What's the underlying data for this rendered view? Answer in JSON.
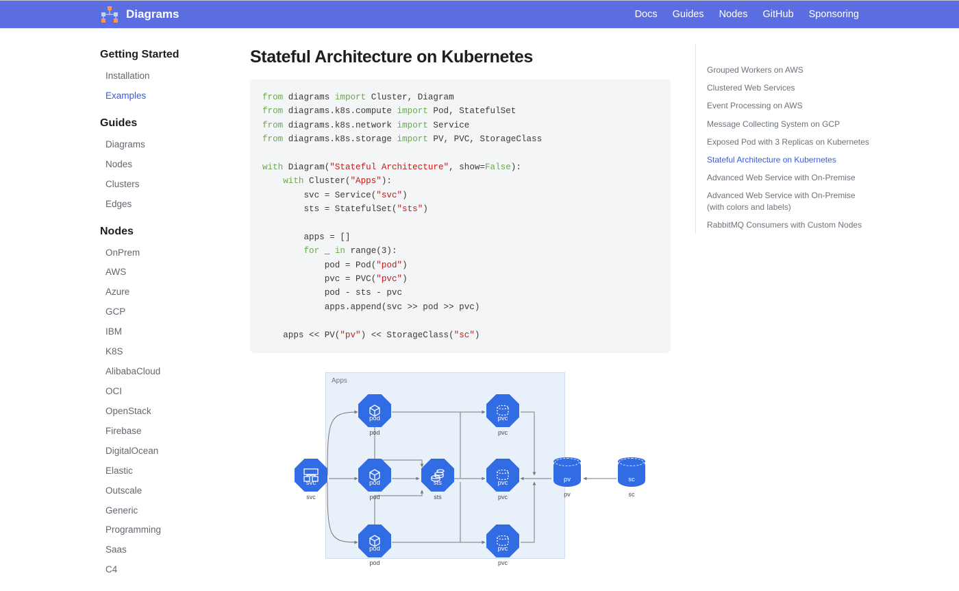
{
  "brand": "Diagrams",
  "nav": [
    "Docs",
    "Guides",
    "Nodes",
    "GitHub",
    "Sponsoring"
  ],
  "sidebar_left": [
    {
      "heading": "Getting Started",
      "items": [
        {
          "label": "Installation",
          "active": false
        },
        {
          "label": "Examples",
          "active": true
        }
      ]
    },
    {
      "heading": "Guides",
      "items": [
        {
          "label": "Diagrams"
        },
        {
          "label": "Nodes"
        },
        {
          "label": "Clusters"
        },
        {
          "label": "Edges"
        }
      ]
    },
    {
      "heading": "Nodes",
      "items": [
        {
          "label": "OnPrem"
        },
        {
          "label": "AWS"
        },
        {
          "label": "Azure"
        },
        {
          "label": "GCP"
        },
        {
          "label": "IBM"
        },
        {
          "label": "K8S"
        },
        {
          "label": "AlibabaCloud"
        },
        {
          "label": "OCI"
        },
        {
          "label": "OpenStack"
        },
        {
          "label": "Firebase"
        },
        {
          "label": "DigitalOcean"
        },
        {
          "label": "Elastic"
        },
        {
          "label": "Outscale"
        },
        {
          "label": "Generic"
        },
        {
          "label": "Programming"
        },
        {
          "label": "Saas"
        },
        {
          "label": "C4"
        }
      ]
    }
  ],
  "page_title": "Stateful Architecture on Kubernetes",
  "code_lines": [
    [
      {
        "t": "from ",
        "c": "kw"
      },
      {
        "t": "diagrams "
      },
      {
        "t": "import ",
        "c": "kw"
      },
      {
        "t": "Cluster, Diagram"
      }
    ],
    [
      {
        "t": "from ",
        "c": "kw"
      },
      {
        "t": "diagrams.k8s.compute "
      },
      {
        "t": "import ",
        "c": "kw"
      },
      {
        "t": "Pod, StatefulSet"
      }
    ],
    [
      {
        "t": "from ",
        "c": "kw"
      },
      {
        "t": "diagrams.k8s.network "
      },
      {
        "t": "import ",
        "c": "kw"
      },
      {
        "t": "Service"
      }
    ],
    [
      {
        "t": "from ",
        "c": "kw"
      },
      {
        "t": "diagrams.k8s.storage "
      },
      {
        "t": "import ",
        "c": "kw"
      },
      {
        "t": "PV, PVC, StorageClass"
      }
    ],
    [],
    [
      {
        "t": "with ",
        "c": "kw"
      },
      {
        "t": "Diagram("
      },
      {
        "t": "\"Stateful Architecture\"",
        "c": "str"
      },
      {
        "t": ", show="
      },
      {
        "t": "False",
        "c": "lit"
      },
      {
        "t": "):"
      }
    ],
    [
      {
        "t": "    "
      },
      {
        "t": "with ",
        "c": "kw"
      },
      {
        "t": "Cluster("
      },
      {
        "t": "\"Apps\"",
        "c": "str"
      },
      {
        "t": "):"
      }
    ],
    [
      {
        "t": "        svc = Service("
      },
      {
        "t": "\"svc\"",
        "c": "str"
      },
      {
        "t": ")"
      }
    ],
    [
      {
        "t": "        sts = StatefulSet("
      },
      {
        "t": "\"sts\"",
        "c": "str"
      },
      {
        "t": ")"
      }
    ],
    [],
    [
      {
        "t": "        apps = []"
      }
    ],
    [
      {
        "t": "        "
      },
      {
        "t": "for ",
        "c": "kw"
      },
      {
        "t": "_ "
      },
      {
        "t": "in ",
        "c": "kw"
      },
      {
        "t": "range("
      },
      {
        "t": "3"
      },
      {
        "t": "):"
      }
    ],
    [
      {
        "t": "            pod = Pod("
      },
      {
        "t": "\"pod\"",
        "c": "str"
      },
      {
        "t": ")"
      }
    ],
    [
      {
        "t": "            pvc = PVC("
      },
      {
        "t": "\"pvc\"",
        "c": "str"
      },
      {
        "t": ")"
      }
    ],
    [
      {
        "t": "            pod - sts - pvc"
      }
    ],
    [
      {
        "t": "            apps.append(svc >> pod >> pvc)"
      }
    ],
    [],
    [
      {
        "t": "    apps << PV("
      },
      {
        "t": "\"pv\"",
        "c": "str"
      },
      {
        "t": ") << StorageClass("
      },
      {
        "t": "\"sc\"",
        "c": "str"
      },
      {
        "t": ")"
      }
    ]
  ],
  "diagram": {
    "cluster_label": "Apps",
    "nodes": {
      "svc": {
        "label": "svc",
        "caption": "svc"
      },
      "pod": {
        "label": "pod",
        "caption": "pod"
      },
      "sts": {
        "label": "sts",
        "caption": "sts"
      },
      "pvc": {
        "label": "pvc",
        "caption": "pvc"
      },
      "pv": {
        "label": "pv",
        "caption": "pv"
      },
      "sc": {
        "label": "sc",
        "caption": "sc"
      }
    }
  },
  "toc": [
    "Grouped Workers on AWS",
    "Clustered Web Services",
    "Event Processing on AWS",
    "Message Collecting System on GCP",
    "Exposed Pod with 3 Replicas on Kubernetes",
    "Stateful Architecture on Kubernetes",
    "Advanced Web Service with On-Premise",
    "Advanced Web Service with On-Premise (with colors and labels)",
    "RabbitMQ Consumers with Custom Nodes"
  ],
  "toc_active_index": 5
}
